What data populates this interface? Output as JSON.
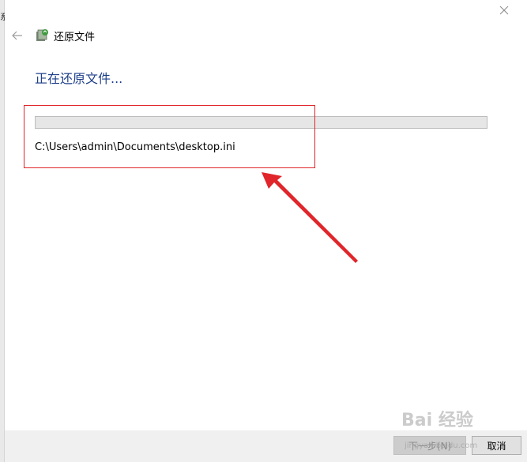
{
  "background_window": {
    "edge_char": "系"
  },
  "header": {
    "back_icon": "back-arrow-icon",
    "app_icon": "file-history-icon",
    "title": "还原文件"
  },
  "main": {
    "heading": "正在还原文件...",
    "progress": 0,
    "current_file": "C:\\Users\\admin\\Documents\\desktop.ini"
  },
  "footer": {
    "next_label": "下一步(N)",
    "cancel_label": "取消"
  },
  "watermark": {
    "text": "Bai 经验",
    "sub": "jingyan.baidu.com"
  },
  "annotation": {
    "color": "#e0262b"
  }
}
